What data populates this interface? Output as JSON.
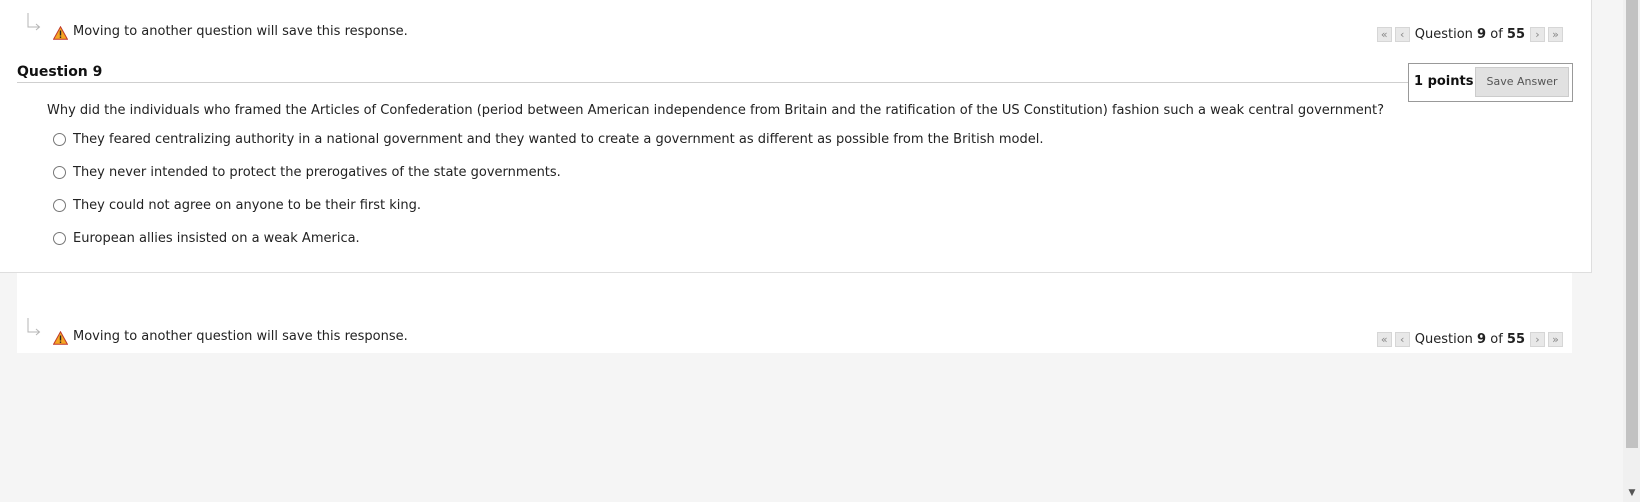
{
  "notice": {
    "icon": "warning-icon",
    "text": "Moving to another question will save this response."
  },
  "pager": {
    "first_icon": "double-chevron-left-icon",
    "prev_icon": "chevron-left-icon",
    "next_icon": "chevron-right-icon",
    "last_icon": "double-chevron-right-icon",
    "first_glyph": "«",
    "prev_glyph": "‹",
    "next_glyph": "›",
    "last_glyph": "»",
    "label_prefix": "Question",
    "current": "9",
    "of_label": "of",
    "total": "55"
  },
  "question": {
    "title": "Question 9",
    "points": "1 points",
    "save_label": "Save Answer",
    "text": "Why did the individuals who framed the Articles of Confederation (period between American independence from Britain and the ratification of the US Constitution) fashion such a weak central government?",
    "options": [
      "They feared centralizing authority in a national government and they wanted to create a government as different as possible from the British model.",
      "They never intended to protect the prerogatives of the state governments.",
      "They could not agree on anyone to be their first king.",
      "European allies insisted on a weak America."
    ]
  },
  "colors": {
    "page_bg": "#f5f5f5",
    "card_bg": "#ffffff",
    "warning_fill": "#f5a623",
    "save_button_bg": "#e1e1e1"
  }
}
